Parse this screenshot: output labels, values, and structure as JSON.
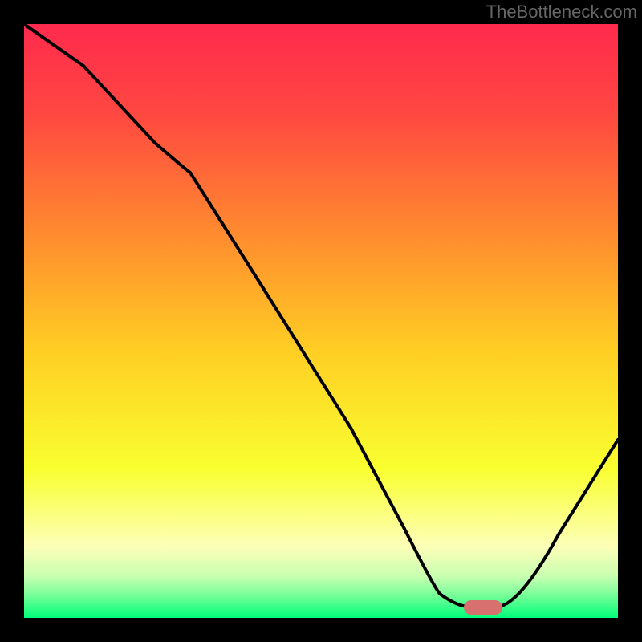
{
  "watermark": "TheBottleneck.com",
  "chart_data": {
    "type": "line",
    "title": "",
    "xlabel": "",
    "ylabel": "",
    "xlim": [
      0,
      100
    ],
    "ylim": [
      0,
      100
    ],
    "background": {
      "type": "gradient",
      "direction": "vertical",
      "stops": [
        {
          "pos": 0.0,
          "color": "#ff2a4d"
        },
        {
          "pos": 0.15,
          "color": "#ff4741"
        },
        {
          "pos": 0.35,
          "color": "#ff8a2f"
        },
        {
          "pos": 0.55,
          "color": "#ffce23"
        },
        {
          "pos": 0.75,
          "color": "#f9ff30"
        },
        {
          "pos": 0.88,
          "color": "#fdffb8"
        },
        {
          "pos": 0.93,
          "color": "#c8ffb0"
        },
        {
          "pos": 0.96,
          "color": "#7cff9a"
        },
        {
          "pos": 1.0,
          "color": "#00ff7a"
        }
      ]
    },
    "series": [
      {
        "name": "bottleneck-curve",
        "color": "#000000",
        "x": [
          0,
          10,
          22,
          28,
          40,
          55,
          64,
          70,
          75,
          80,
          90,
          100
        ],
        "y": [
          100,
          93,
          80,
          75,
          56,
          32,
          15,
          4,
          2,
          2,
          14,
          30
        ]
      }
    ],
    "marker": {
      "name": "optimum-marker",
      "shape": "rounded-bar",
      "color": "#d97070",
      "x": 77,
      "y": 2,
      "width": 6,
      "height": 3
    },
    "grid": false,
    "legend": false
  }
}
